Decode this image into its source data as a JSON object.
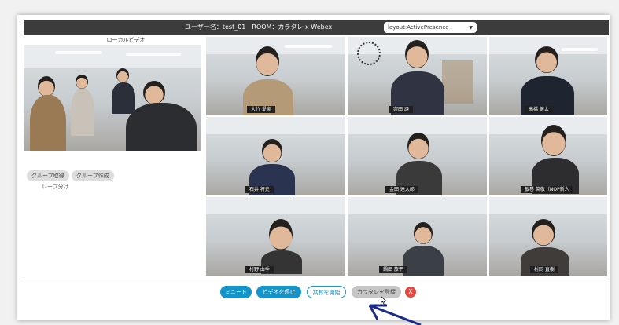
{
  "header": {
    "info_text": "ユーザー名：test_01　ROOM：カラタレ x Webex",
    "layout_select": {
      "value": "layout:ActivePresence"
    }
  },
  "local_video": {
    "label": "ローカルビデオ"
  },
  "group_buttons": {
    "get": "グループ取得",
    "create": "グループ作成"
  },
  "group_split_text": "レープ分け",
  "participants": [
    {
      "name": "大竹 愛実"
    },
    {
      "name": "窪田 頌"
    },
    {
      "name": "高橋 健太"
    },
    {
      "name": "石井 将史"
    },
    {
      "name": "金田 達太郎"
    },
    {
      "name": "板巻 英敬（NOP新人"
    },
    {
      "name": "村野 由季"
    },
    {
      "name": "鍋田 旅平"
    },
    {
      "name": "村岡 直樹"
    }
  ],
  "controls": {
    "mute": "ミュート",
    "stop_video": "ビデオを停止",
    "share": "共有を開始",
    "karatere": "カラタレを登録",
    "close": "X"
  },
  "colors": {
    "accent": "#1494c8",
    "close": "#e34a3c",
    "topbar": "#3c3c3c"
  }
}
